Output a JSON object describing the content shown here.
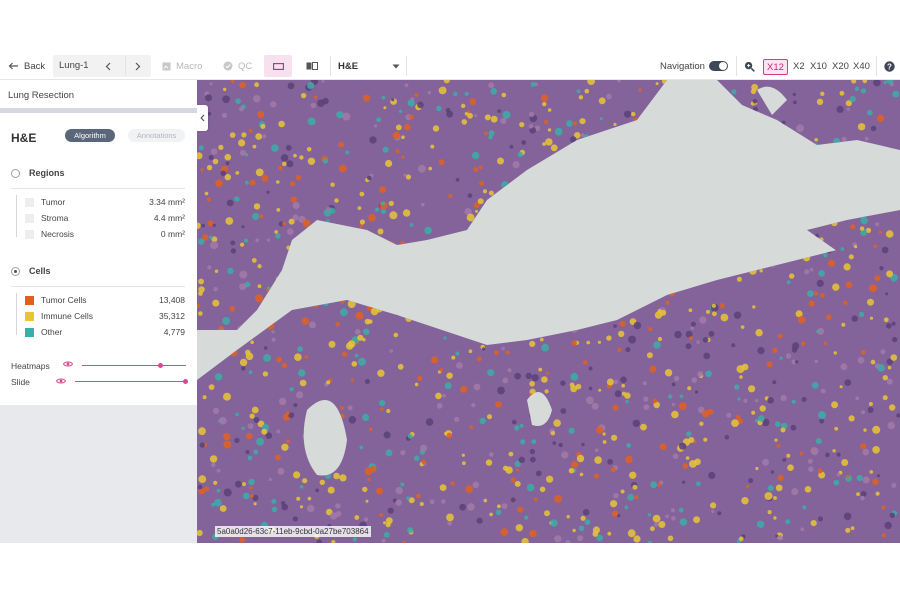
{
  "toolbar": {
    "back_label": "Back",
    "case_name": "Lung-1",
    "macro_label": "Macro",
    "qc_label": "QC",
    "stain_selected": "H&E",
    "navigation_label": "Navigation",
    "navigation_toggle": true,
    "zoom_levels": [
      "X12",
      "X2",
      "X10",
      "X20",
      "X40"
    ],
    "zoom_active": "X12",
    "help_label": "?"
  },
  "panel": {
    "case_title": "Lung Resection",
    "stain_title": "H&E",
    "tabs": [
      {
        "label": "Algorithm",
        "active": true
      },
      {
        "label": "Annotations",
        "active": false
      }
    ],
    "regions": {
      "title": "Regions",
      "selected": false,
      "items": [
        {
          "label": "Tumor",
          "value": "3.34 mm²",
          "color": "#eeeeee"
        },
        {
          "label": "Stroma",
          "value": "4.4 mm²",
          "color": "#eeeeee"
        },
        {
          "label": "Necrosis",
          "value": "0 mm²",
          "color": "#eeeeee"
        }
      ]
    },
    "cells": {
      "title": "Cells",
      "selected": true,
      "items": [
        {
          "label": "Tumor Cells",
          "value": "13,408",
          "color": "#e0601e"
        },
        {
          "label": "Immune Cells",
          "value": "35,312",
          "color": "#e9c534"
        },
        {
          "label": "Other",
          "value": "4,779",
          "color": "#3aaea7"
        }
      ]
    },
    "sliders": [
      {
        "label": "Heatmaps",
        "level": 0.76
      },
      {
        "label": "Slide",
        "level": 1.0
      }
    ]
  },
  "viewer": {
    "slide_id": "5a0a0d26-63c7-11eb-9cbd-0a27be703864"
  },
  "colors": {
    "accent": "#d44b93",
    "pill_active": "#5a6679",
    "tumor_cell": "#e0601e",
    "immune_cell": "#e9c534",
    "other_cell": "#3aaea7",
    "tissue_purple": "#7d5c94",
    "background_glass": "#d6dad8"
  }
}
